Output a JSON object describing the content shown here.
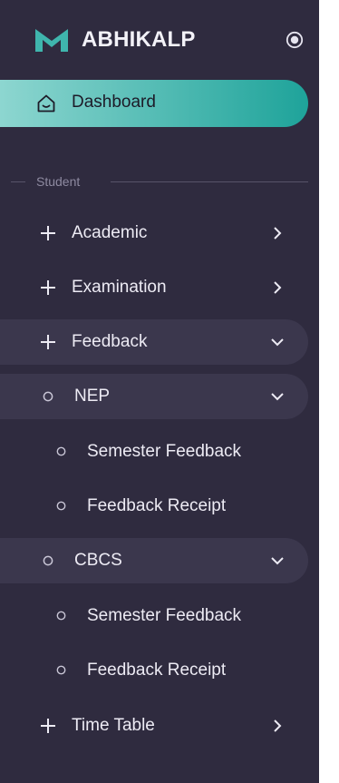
{
  "brand": {
    "name": "ABHIKALP",
    "logo_icon": "m-logo-icon",
    "logo_color": "#3fb5ad"
  },
  "dashboard": {
    "label": "Dashboard",
    "icon": "home-icon",
    "active": true
  },
  "section": {
    "label": "Student"
  },
  "menu": {
    "academic": {
      "label": "Academic",
      "expanded": false
    },
    "examination": {
      "label": "Examination",
      "expanded": false
    },
    "feedback": {
      "label": "Feedback",
      "expanded": true
    },
    "nep": {
      "label": "NEP",
      "expanded": true,
      "items": [
        {
          "label": "Semester Feedback"
        },
        {
          "label": "Feedback Receipt"
        }
      ]
    },
    "cbcs": {
      "label": "CBCS",
      "expanded": true,
      "items": [
        {
          "label": "Semester Feedback"
        },
        {
          "label": "Feedback Receipt"
        }
      ]
    },
    "timetable": {
      "label": "Time Table",
      "expanded": false
    }
  },
  "colors": {
    "sidebar_bg": "#2f2b3f",
    "active_gradient_start": "#8dd6d0",
    "active_gradient_end": "#1ea39a",
    "open_item_bg": "#3b374d"
  }
}
